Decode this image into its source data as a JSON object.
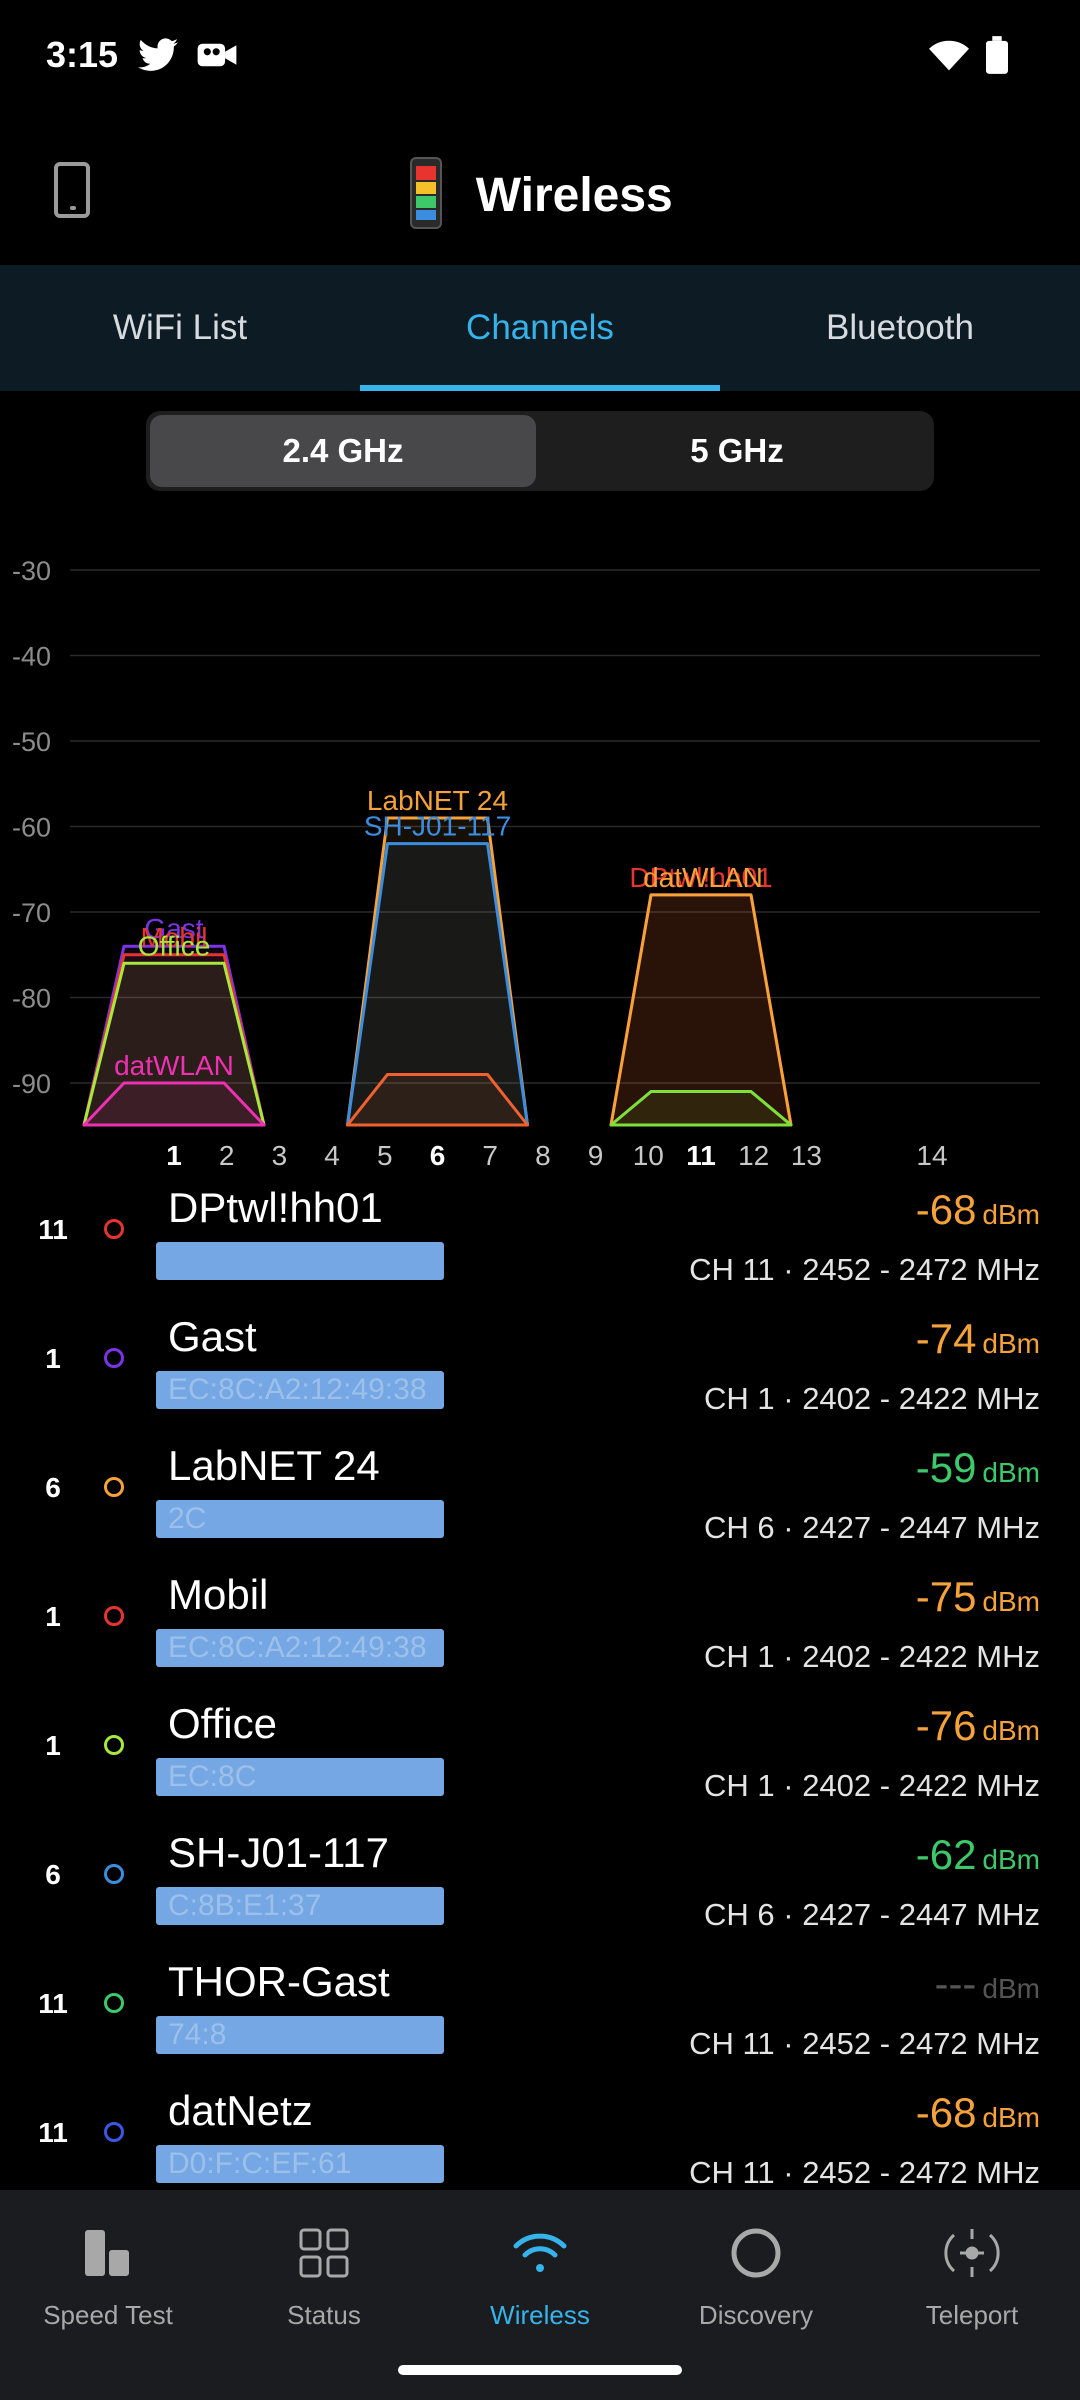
{
  "status_bar": {
    "time": "3:15",
    "icons": [
      "twitter-icon",
      "video-camera-icon",
      "wifi-icon",
      "battery-icon"
    ]
  },
  "header": {
    "title": "Wireless",
    "left_icon": "phone-device-icon"
  },
  "tabs": [
    {
      "label": "WiFi List",
      "active": false
    },
    {
      "label": "Channels",
      "active": true
    },
    {
      "label": "Bluetooth",
      "active": false
    }
  ],
  "band_toggle": {
    "options": [
      "2.4 GHz",
      "5 GHz"
    ],
    "selected": "2.4 GHz"
  },
  "colors": {
    "accent": "#35b3ea",
    "good": "#3dc96a",
    "fair": "#f6a23a",
    "tab_bar_bg": "#0d1b24"
  },
  "chart_data": {
    "type": "area",
    "y_ticks": [
      "-30",
      "-40",
      "-50",
      "-60",
      "-70",
      "-80",
      "-90"
    ],
    "ylim": [
      -95,
      -30
    ],
    "x_ticks": [
      "1",
      "2",
      "3",
      "4",
      "5",
      "6",
      "7",
      "8",
      "9",
      "10",
      "11",
      "12",
      "13",
      "14"
    ],
    "x_bold": [
      "1",
      "6",
      "11"
    ],
    "grid": true,
    "series": [
      {
        "name": "Gast",
        "channel": 1,
        "dbm": -74,
        "color": "#7b33e6",
        "labelled": true
      },
      {
        "name": "Mobil",
        "channel": 1,
        "dbm": -75,
        "color": "#e8342f",
        "labelled": true
      },
      {
        "name": "Office",
        "channel": 1,
        "dbm": -76,
        "color": "#a8e83c",
        "labelled": true
      },
      {
        "name": "datWLAN",
        "channel": 1,
        "dbm": -90,
        "color": "#ee31b2",
        "labelled": true
      },
      {
        "name": "LabNET 24",
        "channel": 6,
        "dbm": -59,
        "color": "#f6a23a",
        "labelled": true
      },
      {
        "name": "SH-J01-117",
        "channel": 6,
        "dbm": -62,
        "color": "#3b8de0",
        "labelled": true
      },
      {
        "name": "",
        "channel": 6,
        "dbm": -89,
        "color": "#f0612f",
        "labelled": false
      },
      {
        "name": "DPtwl!hh01",
        "channel": 11,
        "dbm": -68,
        "color": "#e8342f",
        "labelled": true
      },
      {
        "name": "datWLAN",
        "channel": 11,
        "dbm": -68,
        "color": "#f6a23a",
        "labelled": true
      },
      {
        "name": "",
        "channel": 11,
        "dbm": -91,
        "color": "#7fe03a",
        "labelled": false
      }
    ]
  },
  "networks": [
    {
      "channel": "11",
      "ssid": "DPtwl!hh01",
      "bssid": "",
      "signal": "-68",
      "unit": "dBm",
      "freq": "CH 11 · 2452 - 2472 MHz",
      "ring_color": "#e8342f",
      "signal_color": "#f6a23a"
    },
    {
      "channel": "1",
      "ssid": "Gast",
      "bssid": "EC:8C:A2:12:49:38",
      "signal": "-74",
      "unit": "dBm",
      "freq": "CH 1 · 2402 - 2422 MHz",
      "ring_color": "#7b33e6",
      "signal_color": "#f6a23a"
    },
    {
      "channel": "6",
      "ssid": "LabNET 24",
      "bssid": "2C",
      "signal": "-59",
      "unit": "dBm",
      "freq": "CH 6 · 2427 - 2447 MHz",
      "ring_color": "#f6a23a",
      "signal_color": "#3dc96a"
    },
    {
      "channel": "1",
      "ssid": "Mobil",
      "bssid": "EC:8C:A2:12:49:38",
      "signal": "-75",
      "unit": "dBm",
      "freq": "CH 1 · 2402 - 2422 MHz",
      "ring_color": "#e8342f",
      "signal_color": "#f6a23a"
    },
    {
      "channel": "1",
      "ssid": "Office",
      "bssid": "EC:8C",
      "signal": "-76",
      "unit": "dBm",
      "freq": "CH 1 · 2402 - 2422 MHz",
      "ring_color": "#a8e83c",
      "signal_color": "#f6a23a"
    },
    {
      "channel": "6",
      "ssid": "SH-J01-117",
      "bssid": "C:8B:E1:37",
      "signal": "-62",
      "unit": "dBm",
      "freq": "CH 6 · 2427 - 2447 MHz",
      "ring_color": "#3b8de0",
      "signal_color": "#3dc96a"
    },
    {
      "channel": "11",
      "ssid": "THOR-Gast",
      "bssid": "74:8",
      "signal": "---",
      "unit": "dBm",
      "freq": "CH 11 · 2452 - 2472 MHz",
      "ring_color": "#3dc96a",
      "signal_color": "#555555"
    },
    {
      "channel": "11",
      "ssid": "datNetz",
      "bssid": "D0:F:C:EF:61",
      "signal": "-68",
      "unit": "dBm",
      "freq": "CH 11 · 2452 - 2472 MHz",
      "ring_color": "#3b57e8",
      "signal_color": "#f6a23a"
    }
  ],
  "bottom_nav": [
    {
      "label": "Speed Test",
      "icon": "speed-test-icon",
      "active": false
    },
    {
      "label": "Status",
      "icon": "status-grid-icon",
      "active": false
    },
    {
      "label": "Wireless",
      "icon": "wifi-icon",
      "active": true
    },
    {
      "label": "Discovery",
      "icon": "discovery-circle-icon",
      "active": false
    },
    {
      "label": "Teleport",
      "icon": "teleport-icon",
      "active": false
    }
  ]
}
